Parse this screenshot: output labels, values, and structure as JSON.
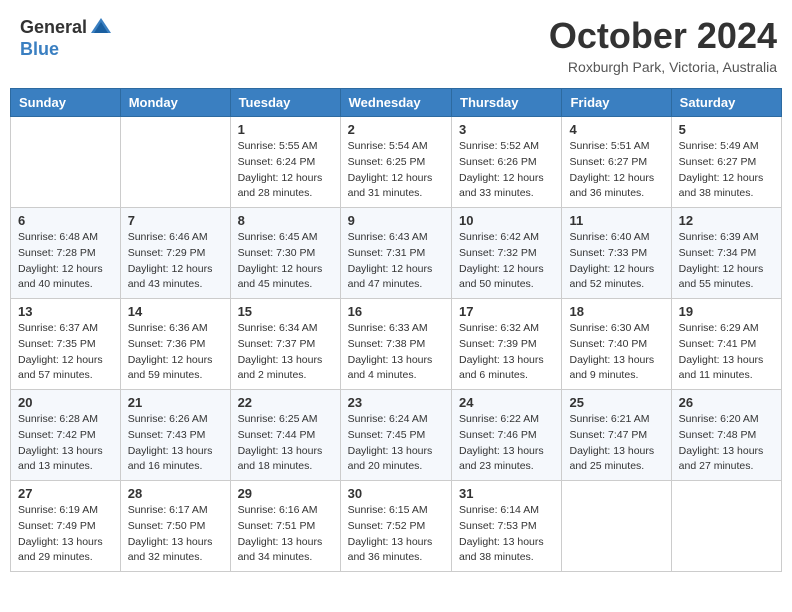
{
  "header": {
    "logo_general": "General",
    "logo_blue": "Blue",
    "month_title": "October 2024",
    "location": "Roxburgh Park, Victoria, Australia"
  },
  "days_of_week": [
    "Sunday",
    "Monday",
    "Tuesday",
    "Wednesday",
    "Thursday",
    "Friday",
    "Saturday"
  ],
  "weeks": [
    [
      {
        "day": "",
        "sunrise": "",
        "sunset": "",
        "daylight": ""
      },
      {
        "day": "",
        "sunrise": "",
        "sunset": "",
        "daylight": ""
      },
      {
        "day": "1",
        "sunrise": "Sunrise: 5:55 AM",
        "sunset": "Sunset: 6:24 PM",
        "daylight": "Daylight: 12 hours and 28 minutes."
      },
      {
        "day": "2",
        "sunrise": "Sunrise: 5:54 AM",
        "sunset": "Sunset: 6:25 PM",
        "daylight": "Daylight: 12 hours and 31 minutes."
      },
      {
        "day": "3",
        "sunrise": "Sunrise: 5:52 AM",
        "sunset": "Sunset: 6:26 PM",
        "daylight": "Daylight: 12 hours and 33 minutes."
      },
      {
        "day": "4",
        "sunrise": "Sunrise: 5:51 AM",
        "sunset": "Sunset: 6:27 PM",
        "daylight": "Daylight: 12 hours and 36 minutes."
      },
      {
        "day": "5",
        "sunrise": "Sunrise: 5:49 AM",
        "sunset": "Sunset: 6:27 PM",
        "daylight": "Daylight: 12 hours and 38 minutes."
      }
    ],
    [
      {
        "day": "6",
        "sunrise": "Sunrise: 6:48 AM",
        "sunset": "Sunset: 7:28 PM",
        "daylight": "Daylight: 12 hours and 40 minutes."
      },
      {
        "day": "7",
        "sunrise": "Sunrise: 6:46 AM",
        "sunset": "Sunset: 7:29 PM",
        "daylight": "Daylight: 12 hours and 43 minutes."
      },
      {
        "day": "8",
        "sunrise": "Sunrise: 6:45 AM",
        "sunset": "Sunset: 7:30 PM",
        "daylight": "Daylight: 12 hours and 45 minutes."
      },
      {
        "day": "9",
        "sunrise": "Sunrise: 6:43 AM",
        "sunset": "Sunset: 7:31 PM",
        "daylight": "Daylight: 12 hours and 47 minutes."
      },
      {
        "day": "10",
        "sunrise": "Sunrise: 6:42 AM",
        "sunset": "Sunset: 7:32 PM",
        "daylight": "Daylight: 12 hours and 50 minutes."
      },
      {
        "day": "11",
        "sunrise": "Sunrise: 6:40 AM",
        "sunset": "Sunset: 7:33 PM",
        "daylight": "Daylight: 12 hours and 52 minutes."
      },
      {
        "day": "12",
        "sunrise": "Sunrise: 6:39 AM",
        "sunset": "Sunset: 7:34 PM",
        "daylight": "Daylight: 12 hours and 55 minutes."
      }
    ],
    [
      {
        "day": "13",
        "sunrise": "Sunrise: 6:37 AM",
        "sunset": "Sunset: 7:35 PM",
        "daylight": "Daylight: 12 hours and 57 minutes."
      },
      {
        "day": "14",
        "sunrise": "Sunrise: 6:36 AM",
        "sunset": "Sunset: 7:36 PM",
        "daylight": "Daylight: 12 hours and 59 minutes."
      },
      {
        "day": "15",
        "sunrise": "Sunrise: 6:34 AM",
        "sunset": "Sunset: 7:37 PM",
        "daylight": "Daylight: 13 hours and 2 minutes."
      },
      {
        "day": "16",
        "sunrise": "Sunrise: 6:33 AM",
        "sunset": "Sunset: 7:38 PM",
        "daylight": "Daylight: 13 hours and 4 minutes."
      },
      {
        "day": "17",
        "sunrise": "Sunrise: 6:32 AM",
        "sunset": "Sunset: 7:39 PM",
        "daylight": "Daylight: 13 hours and 6 minutes."
      },
      {
        "day": "18",
        "sunrise": "Sunrise: 6:30 AM",
        "sunset": "Sunset: 7:40 PM",
        "daylight": "Daylight: 13 hours and 9 minutes."
      },
      {
        "day": "19",
        "sunrise": "Sunrise: 6:29 AM",
        "sunset": "Sunset: 7:41 PM",
        "daylight": "Daylight: 13 hours and 11 minutes."
      }
    ],
    [
      {
        "day": "20",
        "sunrise": "Sunrise: 6:28 AM",
        "sunset": "Sunset: 7:42 PM",
        "daylight": "Daylight: 13 hours and 13 minutes."
      },
      {
        "day": "21",
        "sunrise": "Sunrise: 6:26 AM",
        "sunset": "Sunset: 7:43 PM",
        "daylight": "Daylight: 13 hours and 16 minutes."
      },
      {
        "day": "22",
        "sunrise": "Sunrise: 6:25 AM",
        "sunset": "Sunset: 7:44 PM",
        "daylight": "Daylight: 13 hours and 18 minutes."
      },
      {
        "day": "23",
        "sunrise": "Sunrise: 6:24 AM",
        "sunset": "Sunset: 7:45 PM",
        "daylight": "Daylight: 13 hours and 20 minutes."
      },
      {
        "day": "24",
        "sunrise": "Sunrise: 6:22 AM",
        "sunset": "Sunset: 7:46 PM",
        "daylight": "Daylight: 13 hours and 23 minutes."
      },
      {
        "day": "25",
        "sunrise": "Sunrise: 6:21 AM",
        "sunset": "Sunset: 7:47 PM",
        "daylight": "Daylight: 13 hours and 25 minutes."
      },
      {
        "day": "26",
        "sunrise": "Sunrise: 6:20 AM",
        "sunset": "Sunset: 7:48 PM",
        "daylight": "Daylight: 13 hours and 27 minutes."
      }
    ],
    [
      {
        "day": "27",
        "sunrise": "Sunrise: 6:19 AM",
        "sunset": "Sunset: 7:49 PM",
        "daylight": "Daylight: 13 hours and 29 minutes."
      },
      {
        "day": "28",
        "sunrise": "Sunrise: 6:17 AM",
        "sunset": "Sunset: 7:50 PM",
        "daylight": "Daylight: 13 hours and 32 minutes."
      },
      {
        "day": "29",
        "sunrise": "Sunrise: 6:16 AM",
        "sunset": "Sunset: 7:51 PM",
        "daylight": "Daylight: 13 hours and 34 minutes."
      },
      {
        "day": "30",
        "sunrise": "Sunrise: 6:15 AM",
        "sunset": "Sunset: 7:52 PM",
        "daylight": "Daylight: 13 hours and 36 minutes."
      },
      {
        "day": "31",
        "sunrise": "Sunrise: 6:14 AM",
        "sunset": "Sunset: 7:53 PM",
        "daylight": "Daylight: 13 hours and 38 minutes."
      },
      {
        "day": "",
        "sunrise": "",
        "sunset": "",
        "daylight": ""
      },
      {
        "day": "",
        "sunrise": "",
        "sunset": "",
        "daylight": ""
      }
    ]
  ]
}
